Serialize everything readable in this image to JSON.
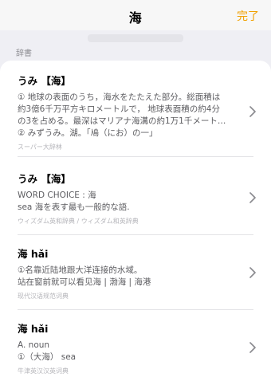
{
  "nav": {
    "title": "海",
    "done_label": "完了"
  },
  "section": {
    "title": "辞書"
  },
  "entries": [
    {
      "title": "うみ 【海】",
      "lines": [
        "① 地球の表面のうち，海水をたたえた部分。総面積は",
        "約3億6千万平方キロメートルで， 地球表面積の約4分",
        "の3を占める。最深はマリアナ海溝の約1万1千メート…",
        "② みずうみ。湖。「鳰（にお）の一」"
      ],
      "source": "スーパー大辞林"
    },
    {
      "title": "うみ 【海】",
      "lines": [
        "WORD CHOICE : 海",
        "sea 海を表す最も一般的な語."
      ],
      "source": "ウィズダム英和辞典 / ウィズダム和英辞典"
    },
    {
      "title": "海 hǎi",
      "lines": [
        "①名靠近陆地跟大洋连接的水域。",
        "站在窗前就可以看见海 | 渤海 | 海港"
      ],
      "source": "现代汉语规范词典"
    },
    {
      "title": "海 hǎi",
      "lines": [
        "A. noun",
        "①（大海） sea"
      ],
      "source": "牛津英汉汉英词典"
    }
  ],
  "colors": {
    "accent": "#f0a000",
    "background": "#efeff4",
    "card": "#ffffff",
    "secondary_text": "#5c5c60",
    "source_text": "#b5b5ba"
  },
  "icons": {
    "row_disclosure": "chevron-right-icon"
  }
}
